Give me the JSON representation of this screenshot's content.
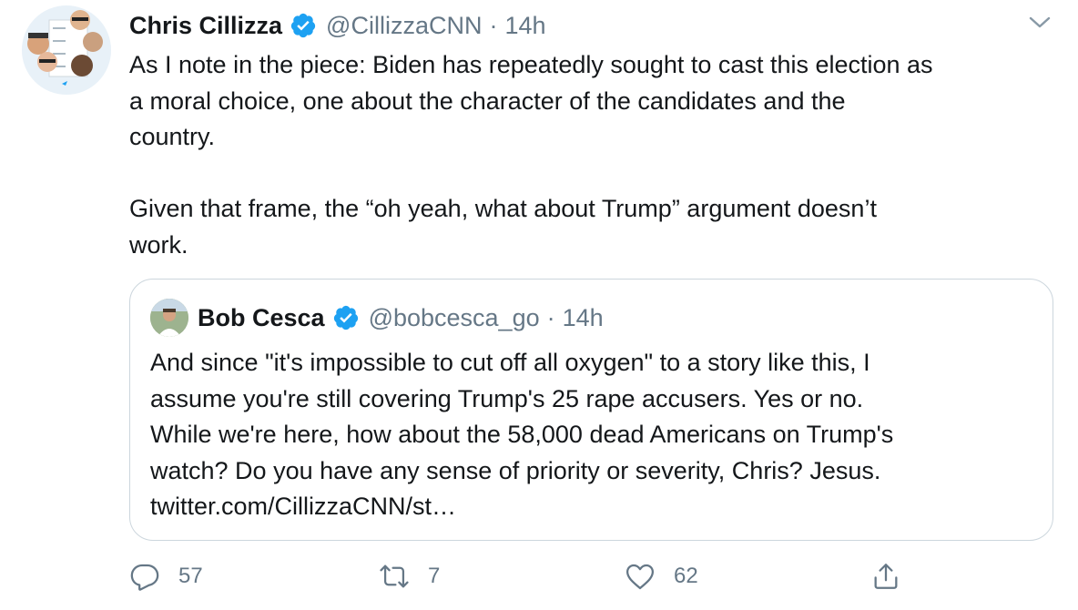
{
  "tweet": {
    "author_name": "Chris Cillizza",
    "author_handle": "@CillizzaCNN",
    "separator": "·",
    "time": "14h",
    "text": "As I note in the piece: Biden has repeatedly sought to cast this election as\na moral choice, one about the character of the candidates and the\ncountry.\n\nGiven that frame, the “oh yeah, what about Trump” argument doesn’t\nwork."
  },
  "quote": {
    "author_name": "Bob Cesca",
    "author_handle": "@bobcesca_go",
    "separator": "·",
    "time": "14h",
    "text": "And since \"it's impossible to cut off all oxygen\" to a story like this, I\nassume you're still covering Trump's 25 rape accusers. Yes or no.\nWhile we're here, how about the 58,000 dead Americans on Trump's\nwatch? Do you have any sense of priority or severity, Chris? Jesus.\ntwitter.com/CillizzaCNN/st…"
  },
  "actions": {
    "reply_count": "57",
    "retweet_count": "7",
    "like_count": "62"
  },
  "icons": {
    "verified": "verified-badge-icon",
    "menu": "chevron-down-icon",
    "reply": "reply-icon",
    "retweet": "retweet-icon",
    "like": "heart-icon",
    "share": "share-icon"
  },
  "colors": {
    "verified_blue": "#1da1f2",
    "secondary_text": "#657786",
    "border": "#ccd6dd",
    "primary_text": "#14171a"
  }
}
